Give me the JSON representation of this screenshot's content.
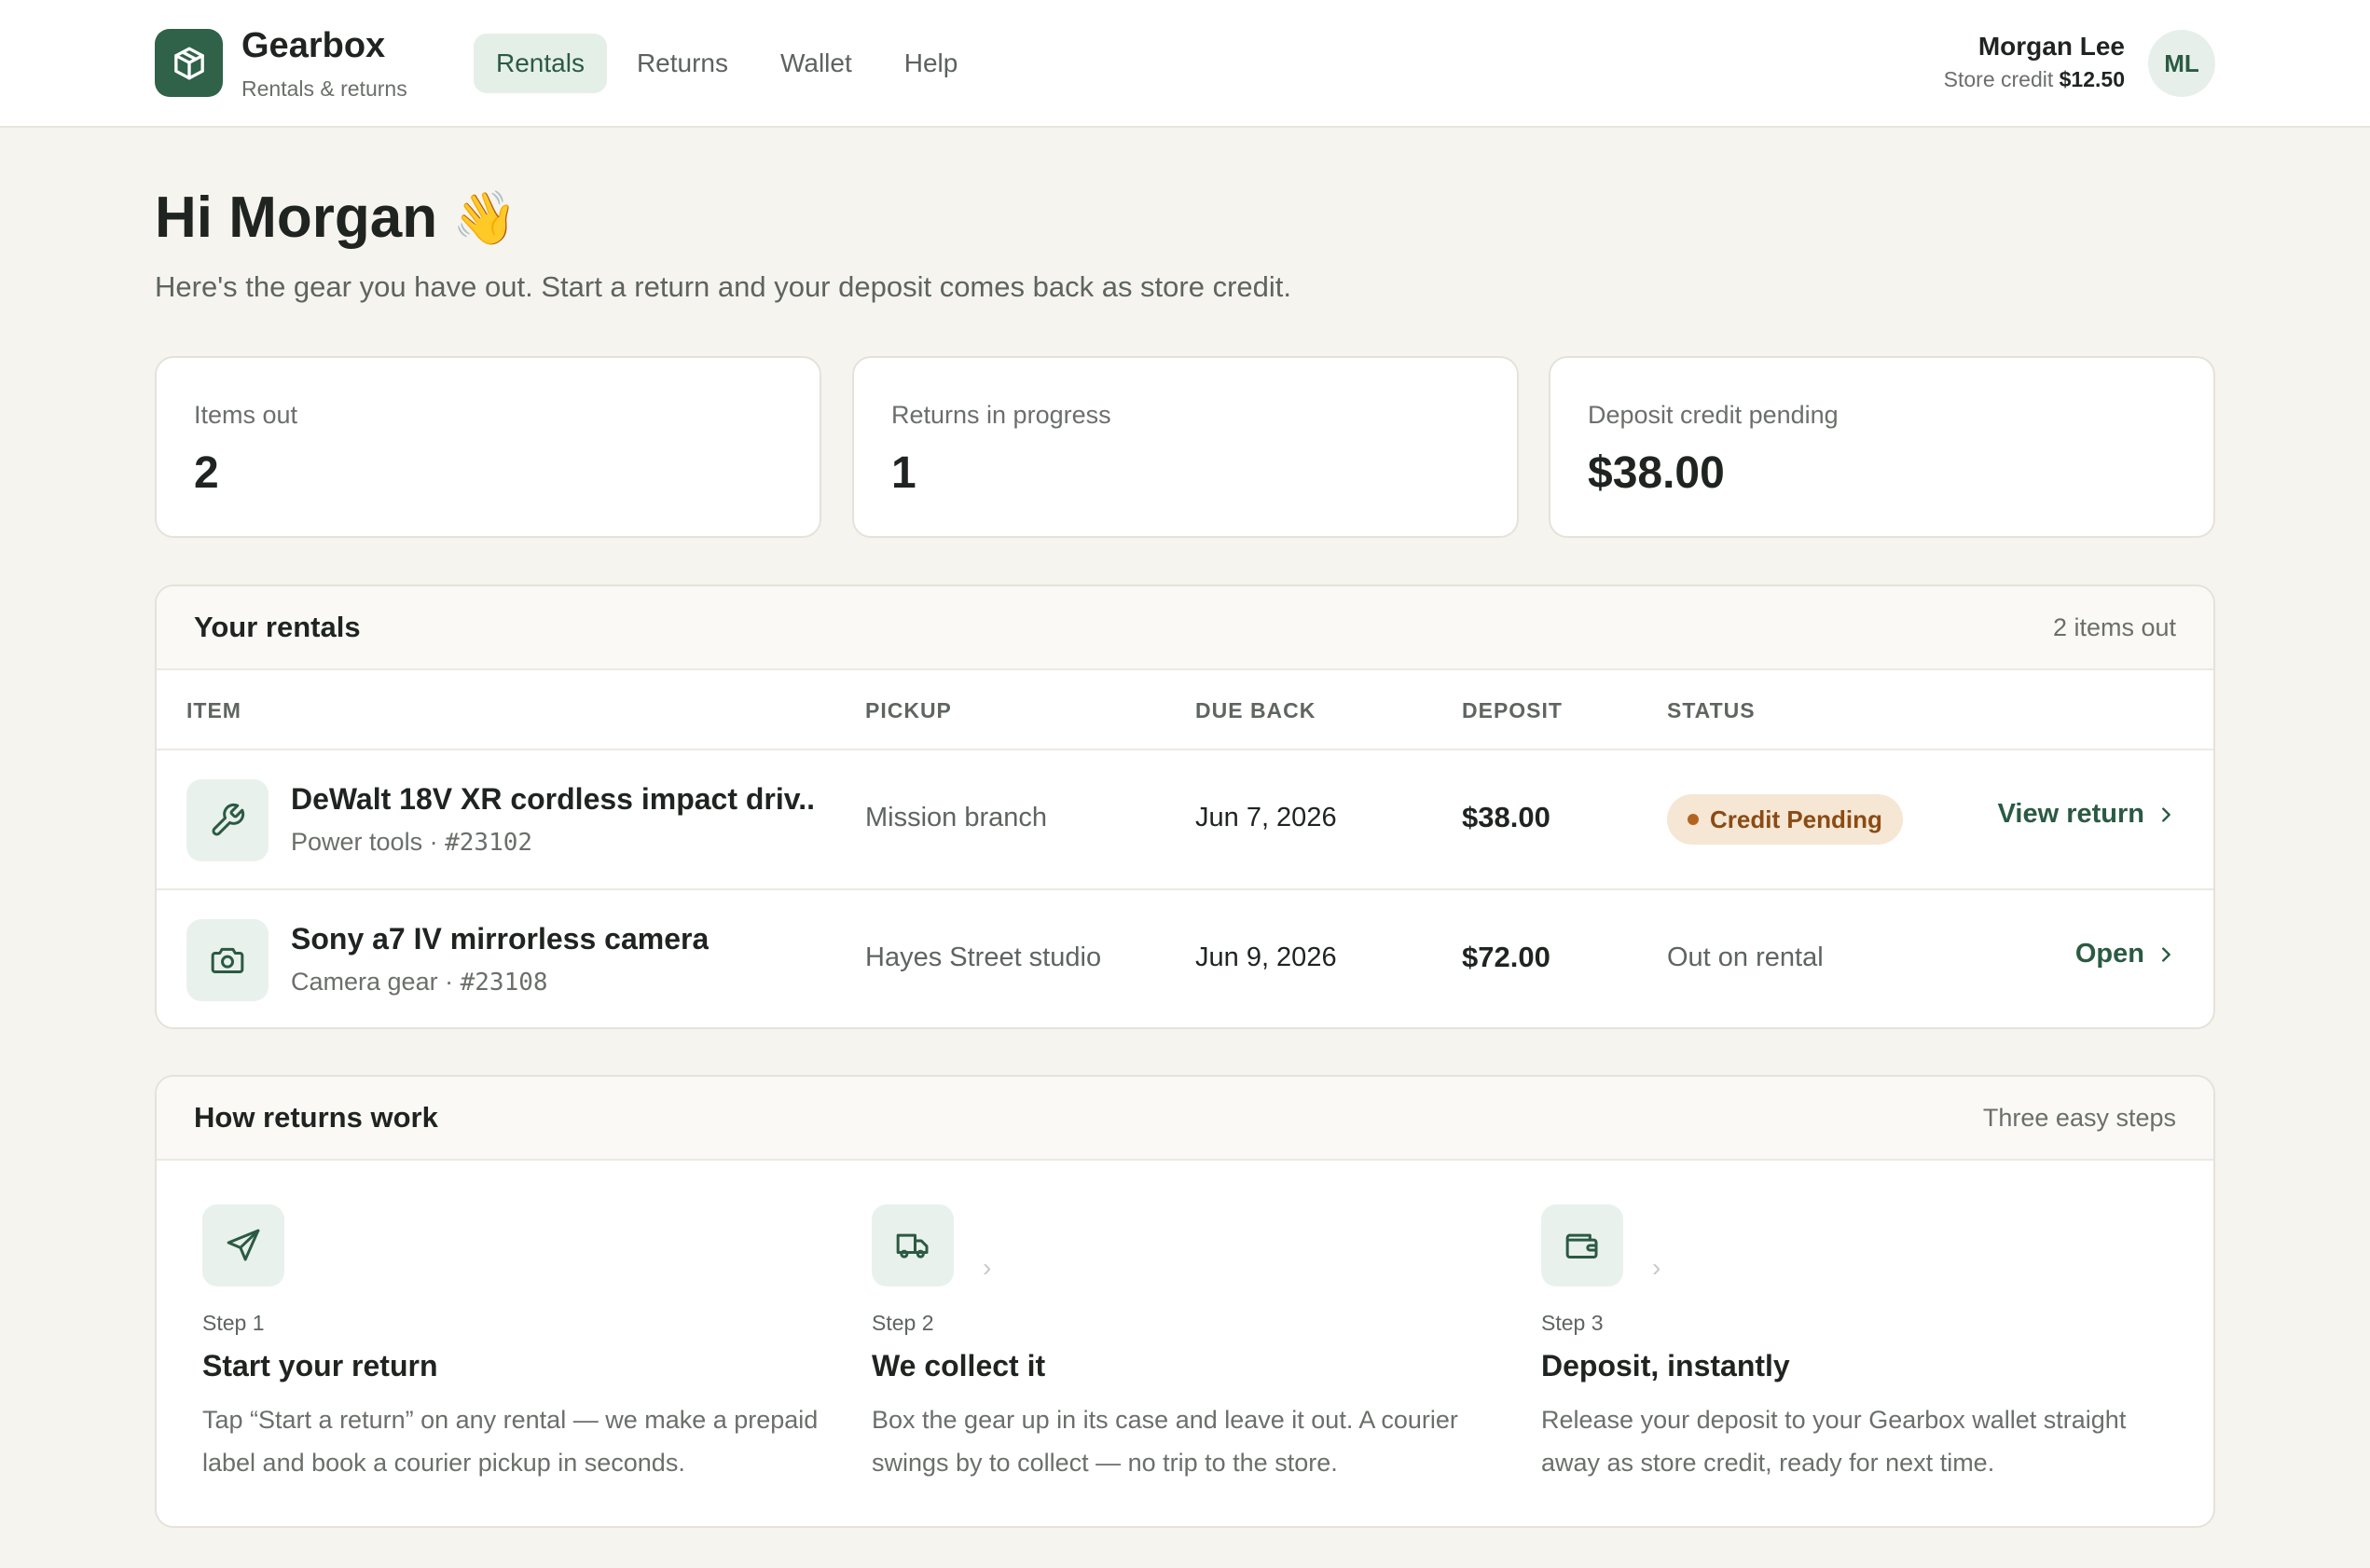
{
  "brand": {
    "name": "Gearbox",
    "subtitle": "Rentals & returns"
  },
  "nav": [
    {
      "label": "Rentals",
      "active": true
    },
    {
      "label": "Returns",
      "active": false
    },
    {
      "label": "Wallet",
      "active": false
    },
    {
      "label": "Help",
      "active": false
    }
  ],
  "user": {
    "name": "Morgan Lee",
    "credit_label": "Store credit",
    "credit_value": "$12.50",
    "initials": "ML"
  },
  "greeting": {
    "title": "Hi Morgan",
    "emoji": "👋",
    "subtitle": "Here's the gear you have out. Start a return and your deposit comes back as store credit."
  },
  "stats": [
    {
      "label": "Items out",
      "value": "2"
    },
    {
      "label": "Returns in progress",
      "value": "1"
    },
    {
      "label": "Deposit credit pending",
      "value": "$38.00"
    }
  ],
  "rentals": {
    "title": "Your rentals",
    "count_label": "2 items out",
    "columns": [
      "ITEM",
      "PICKUP",
      "DUE BACK",
      "DEPOSIT",
      "STATUS"
    ],
    "rows": [
      {
        "icon": "wrench-icon",
        "name": "DeWalt 18V XR cordless impact driv...",
        "category": "Power tools",
        "separator": "·",
        "sku": "#23102",
        "pickup": "Mission branch",
        "due": "Jun 7, 2026",
        "deposit": "$38.00",
        "status": "Credit Pending",
        "action": "View return"
      },
      {
        "icon": "camera-icon",
        "name": "Sony a7 IV mirrorless camera",
        "category": "Camera gear",
        "separator": "·",
        "sku": "#23108",
        "pickup": "Hayes Street studio",
        "due": "Jun 9, 2026",
        "deposit": "$72.00",
        "status": "Out on rental",
        "action": "Open"
      }
    ]
  },
  "how": {
    "title": "How returns work",
    "aside": "Three easy steps",
    "steps": [
      {
        "icon": "send-icon",
        "num": "Step 1",
        "title": "Start your return",
        "desc": "Tap “Start a return” on any rental — we make a prepaid label and book a courier pickup in seconds."
      },
      {
        "icon": "truck-icon",
        "num": "Step 2",
        "title": "We collect it",
        "desc": "Box the gear up in its case and leave it out. A courier swings by to collect — no trip to the store."
      },
      {
        "icon": "wallet-icon",
        "num": "Step 3",
        "title": "Deposit, instantly",
        "desc": "Release your deposit to your Gearbox wallet straight away as store credit, ready for next time."
      }
    ]
  },
  "colors": {
    "brand": "#2f6249",
    "accent_text": "#2b5a43",
    "pending_bg": "#f6e6d4",
    "pending_text": "#8a4b14"
  }
}
